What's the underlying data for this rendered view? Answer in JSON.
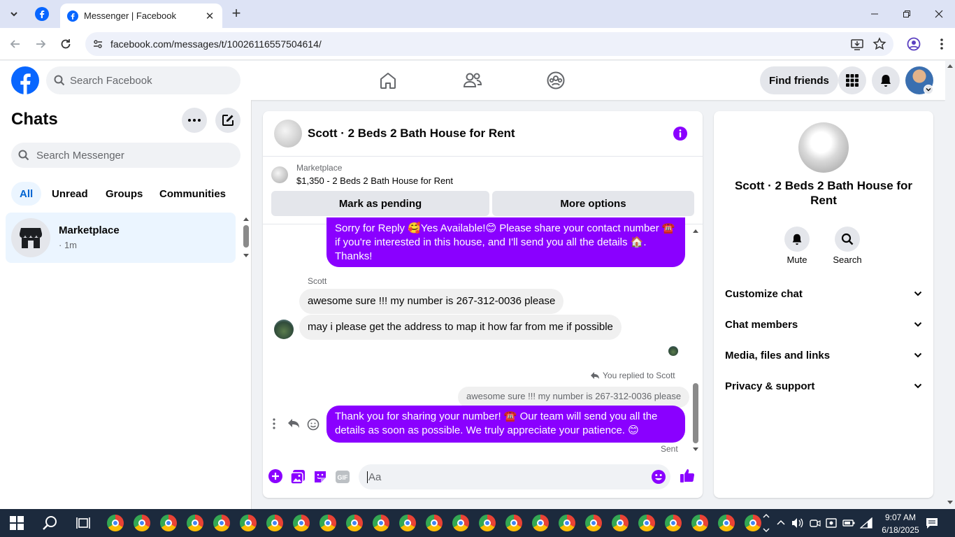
{
  "browser": {
    "tab_title": "Messenger | Facebook",
    "new_tab": "+",
    "url": "facebook.com/messages/t/100261165575046​14/"
  },
  "fb": {
    "search_placeholder": "Search Facebook",
    "find_friends": "Find friends"
  },
  "chats": {
    "title": "Chats",
    "search_placeholder": "Search Messenger",
    "filters": [
      "All",
      "Unread",
      "Groups",
      "Communities"
    ],
    "conversation": {
      "name": "Marketplace",
      "meta": "· 1m"
    }
  },
  "chat": {
    "title": "Scott · 2 Beds 2 Bath House for Rent",
    "listing_source": "Marketplace",
    "listing_title": "$1,350 - 2 Beds 2 Bath House for Rent",
    "mark_pending": "Mark as pending",
    "more_options": "More options",
    "messages": {
      "out1": "Sorry for Reply 🥰Yes Available!😊 Please share your contact number ☎️ if you're interested in this house, and I'll send you all the details 🏠. Thanks!",
      "sender": "Scott",
      "in1": "awesome sure !!! my number is 267-312-0036 please",
      "in2": "may i please get the address to map it how far from me if possible",
      "replied_label": "You replied to Scott",
      "quoted": "awesome sure !!! my number is 267-312-0036 please",
      "out2": "Thank you for sharing your number! ☎️ Our team will send you all the details as soon as possible. We truly appreciate your patience. 😊",
      "status": "Sent"
    },
    "composer_placeholder": "Aa"
  },
  "info": {
    "name": "Scott · 2 Beds 2 Bath House for Rent",
    "mute": "Mute",
    "search": "Search",
    "sections": [
      "Customize chat",
      "Chat members",
      "Media, files and links",
      "Privacy & support"
    ]
  },
  "taskbar": {
    "time": "9:07 AM",
    "date": "6/18/2025"
  },
  "colors": {
    "accent": "#8a00ff",
    "fb_blue": "#0866ff",
    "taskbar": "#1c2a3d"
  }
}
